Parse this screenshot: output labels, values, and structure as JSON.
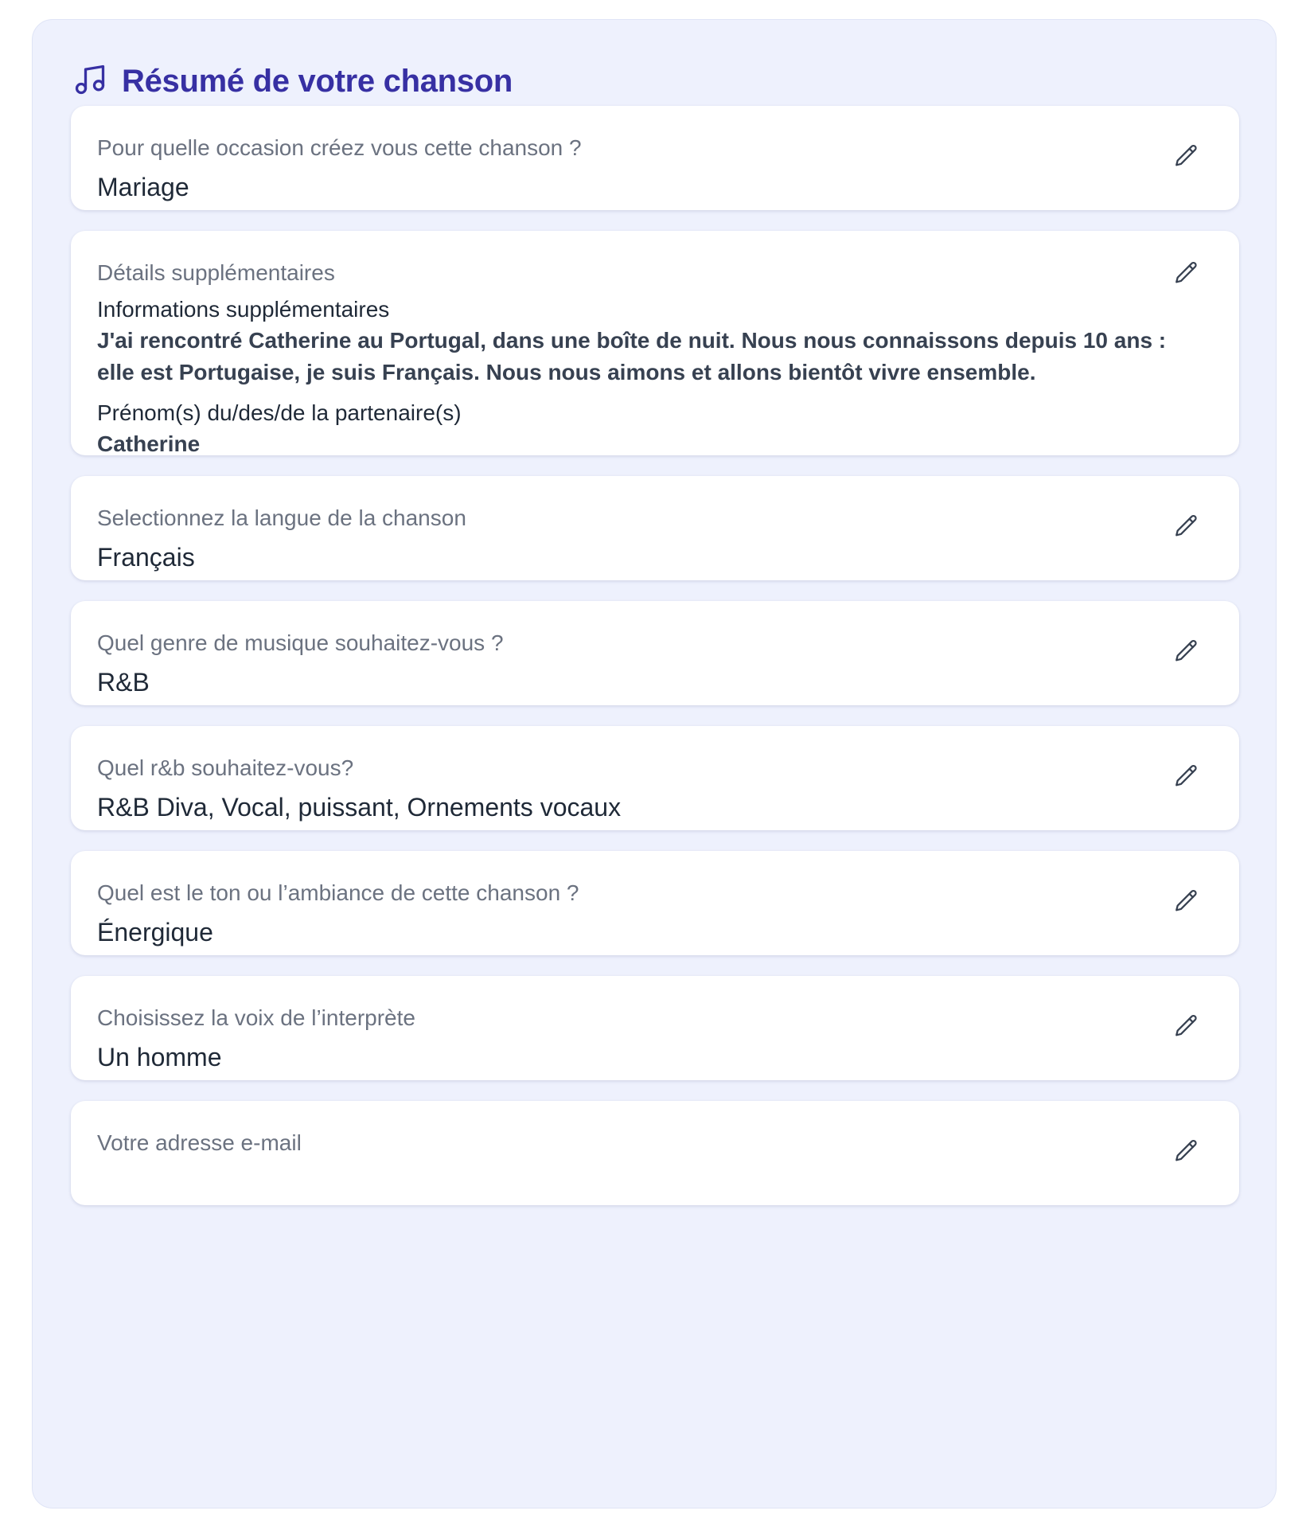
{
  "summary": {
    "title": "Résumé de votre chanson",
    "icon": "music-note-icon",
    "accent_color": "#3730a3",
    "background_color": "#eef1fd"
  },
  "cards": [
    {
      "question": "Pour quelle occasion créez vous cette chanson ?",
      "answer": "Mariage"
    },
    {
      "question": "Détails supplémentaires",
      "details": [
        {
          "label": "Informations supplémentaires",
          "value": "J'ai rencontré Catherine au Portugal, dans une boîte de nuit. Nous nous connaissons depuis 10 ans : elle est Portugaise, je suis Français. Nous nous aimons et allons bientôt vivre ensemble."
        },
        {
          "label": "Prénom(s) du/des/de la partenaire(s)",
          "value": "Catherine"
        }
      ]
    },
    {
      "question": "Selectionnez la langue de la chanson",
      "answer": "Français"
    },
    {
      "question": "Quel genre de musique souhaitez-vous ?",
      "answer": "R&B"
    },
    {
      "question": "Quel r&b souhaitez-vous?",
      "answer": "R&B Diva, Vocal, puissant, Ornements vocaux"
    },
    {
      "question": "Quel est le ton ou l’ambiance de cette chanson ?",
      "answer": "Énergique"
    },
    {
      "question": "Choisissez la voix de l’interprète",
      "answer": "Un homme"
    },
    {
      "question": "Votre adresse e-mail",
      "answer": ""
    }
  ],
  "edit_icon": "pencil-icon"
}
